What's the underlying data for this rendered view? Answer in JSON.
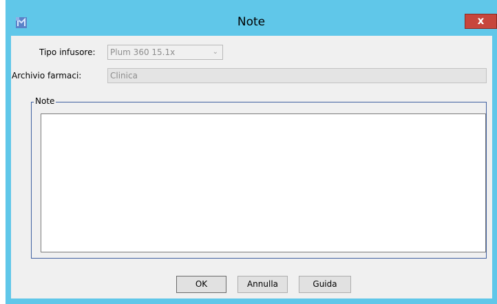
{
  "window": {
    "title": "Note",
    "close_label": "x",
    "accent_color": "#60c7e9",
    "close_color": "#c7463c"
  },
  "form": {
    "infuser_type_label": "Tipo infusore:",
    "infuser_type_value": "Plum 360 15.1x",
    "drug_library_label": "Archivio farmaci:",
    "drug_library_value": "Clinica",
    "notes_group_label": "Note",
    "notes_value": ""
  },
  "buttons": {
    "ok": "OK",
    "cancel": "Annulla",
    "help": "Guida"
  },
  "icons": {
    "app": "app-logo-icon",
    "close": "close-icon",
    "dropdown": "chevron-down-icon"
  }
}
